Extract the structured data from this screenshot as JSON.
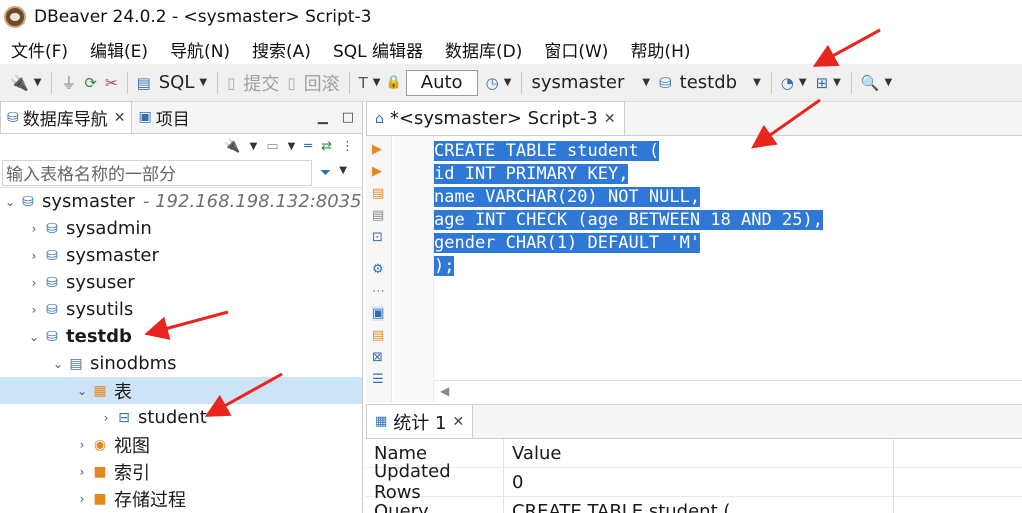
{
  "window": {
    "title": "DBeaver 24.0.2 - <sysmaster> Script-3"
  },
  "menu": [
    "文件(F)",
    "编辑(E)",
    "导航(N)",
    "搜索(A)",
    "SQL 编辑器",
    "数据库(D)",
    "窗口(W)",
    "帮助(H)"
  ],
  "toolbar": {
    "sql_label": "SQL",
    "commit_label": "提交",
    "rollback_label": "回滚",
    "auto_label": "Auto",
    "datasource": "sysmaster",
    "database": "testdb"
  },
  "navigator": {
    "tab_label": "数据库导航",
    "projects_tab_label": "项目",
    "filter_placeholder": "输入表格名称的一部分",
    "connection": {
      "name": "sysmaster",
      "host": " - 192.168.198.132:8035"
    },
    "databases": [
      "sysadmin",
      "sysmaster",
      "sysuser",
      "sysutils",
      "testdb"
    ],
    "schema": "sinodbms",
    "folders": {
      "tables": "表",
      "views": "视图",
      "indexes": "索引",
      "procedures": "存储过程"
    },
    "table": "student"
  },
  "editor": {
    "tab_label": "*<sysmaster> Script-3",
    "lines": [
      "CREATE TABLE student (",
      "id INT PRIMARY KEY,",
      "name VARCHAR(20) NOT NULL,",
      "age INT CHECK (age BETWEEN 18 AND 25),",
      "gender CHAR(1) DEFAULT 'M'",
      ");"
    ]
  },
  "results": {
    "tab_label": "统计 1",
    "columns": [
      "Name",
      "Value"
    ],
    "rows": [
      [
        "Updated Rows",
        "0"
      ],
      [
        "Query",
        "CREATE TABLE student ("
      ]
    ]
  },
  "colors": {
    "annotation": "#e8261d",
    "selection": "#2f78d6",
    "tree_selected": "#cde3f7"
  }
}
